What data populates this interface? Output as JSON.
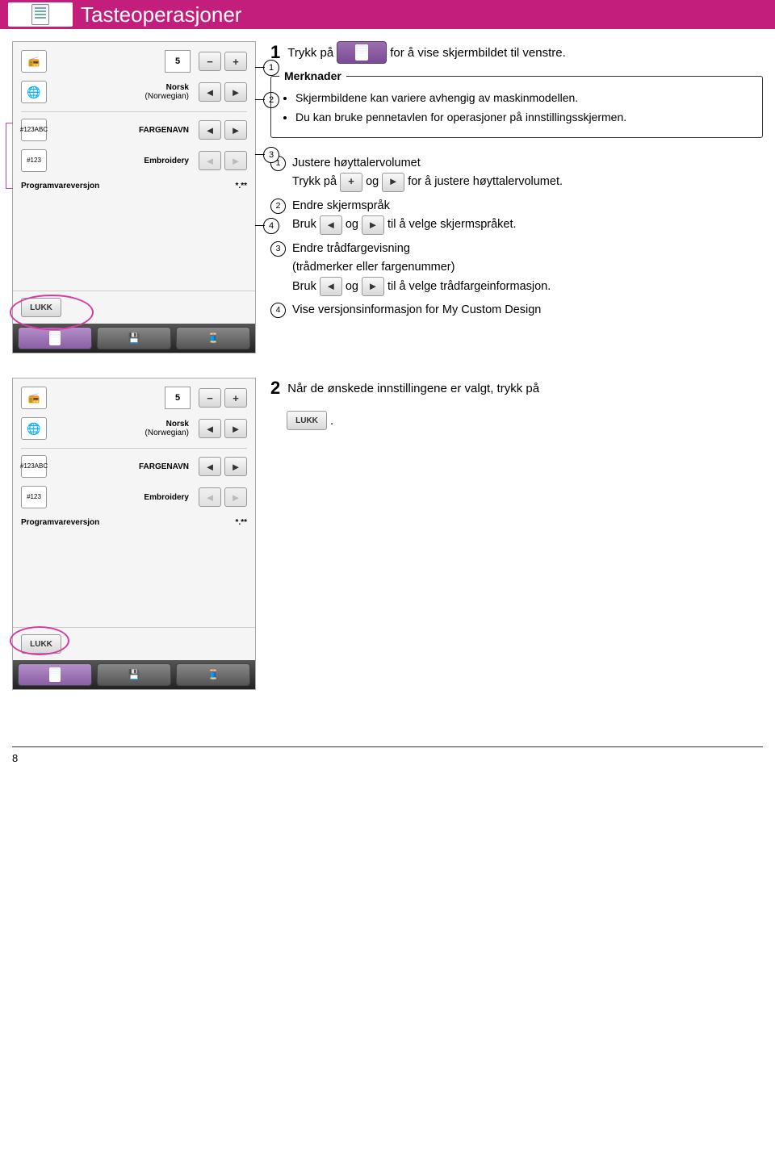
{
  "title": "Tasteoperasjoner",
  "step1": {
    "num": "1",
    "before": "Trykk på",
    "after": "for å vise skjermbildet til venstre."
  },
  "notes": {
    "title": "Merknader",
    "items": [
      "Skjermbildene kan variere avhengig av maskinmodellen.",
      "Du kan bruke pennetavlen for operasjoner på innstillingsskjermen."
    ]
  },
  "screenshot": {
    "volume_value": "5",
    "lang_label": "Norsk",
    "lang_sub": "(Norwegian)",
    "color_icon_top": "#123",
    "color_icon_top2": "ABC",
    "color_label": "FARGENAVN",
    "thread_icon": "#123",
    "thread_label": "Embroidery",
    "sw_label": "Programvareversjon",
    "sw_value": "*.**",
    "close": "LUKK"
  },
  "callouts": {
    "c1": "1",
    "c2": "2",
    "c3": "3",
    "c4": "4"
  },
  "desc": {
    "i1_title": "Justere høyttalervolumet",
    "i1_line_a": "Trykk på",
    "i1_line_b": "og",
    "i1_line_c": "for å justere høyttalervolumet.",
    "i2_title": "Endre skjermspråk",
    "i2_line_a": "Bruk",
    "i2_line_b": "og",
    "i2_line_c": "til å velge skjermspråket.",
    "i3_title": "Endre trådfargevisning",
    "i3_sub": "(trådmerker eller fargenummer)",
    "i3_line_a": "Bruk",
    "i3_line_b": "og",
    "i3_line_c": "til å velge trådfargeinformasjon.",
    "i4_title": "Vise versjonsinformasjon for My Custom Design"
  },
  "step2": {
    "num": "2",
    "text_a": "Når de ønskede innstillingene er valgt, trykk på",
    "text_b": "."
  },
  "page_num": "8"
}
